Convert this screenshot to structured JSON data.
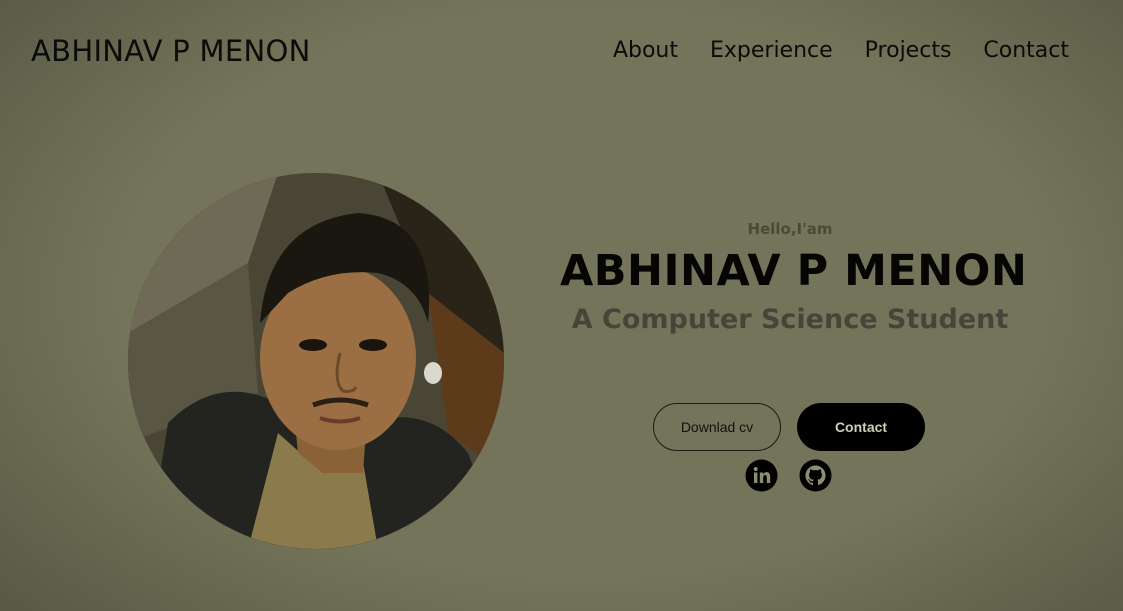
{
  "header": {
    "logo": "ABHINAV P MENON",
    "nav": [
      "About",
      "Experience",
      "Projects",
      "Contact"
    ]
  },
  "profile": {
    "alt": "Profile picture"
  },
  "hero": {
    "greeting": "Hello,I'am",
    "name": "ABHINAV P MENON",
    "subtitle": "A Computer Science Student",
    "buttons": {
      "download_cv": "Downlad cv",
      "contact": "Contact"
    },
    "socials": [
      "linkedin-icon",
      "github-icon"
    ]
  },
  "colors": {
    "background": "#737459",
    "text_dark": "#0b0b09",
    "subtitle": "#45463a",
    "button_dark": "#000000"
  }
}
